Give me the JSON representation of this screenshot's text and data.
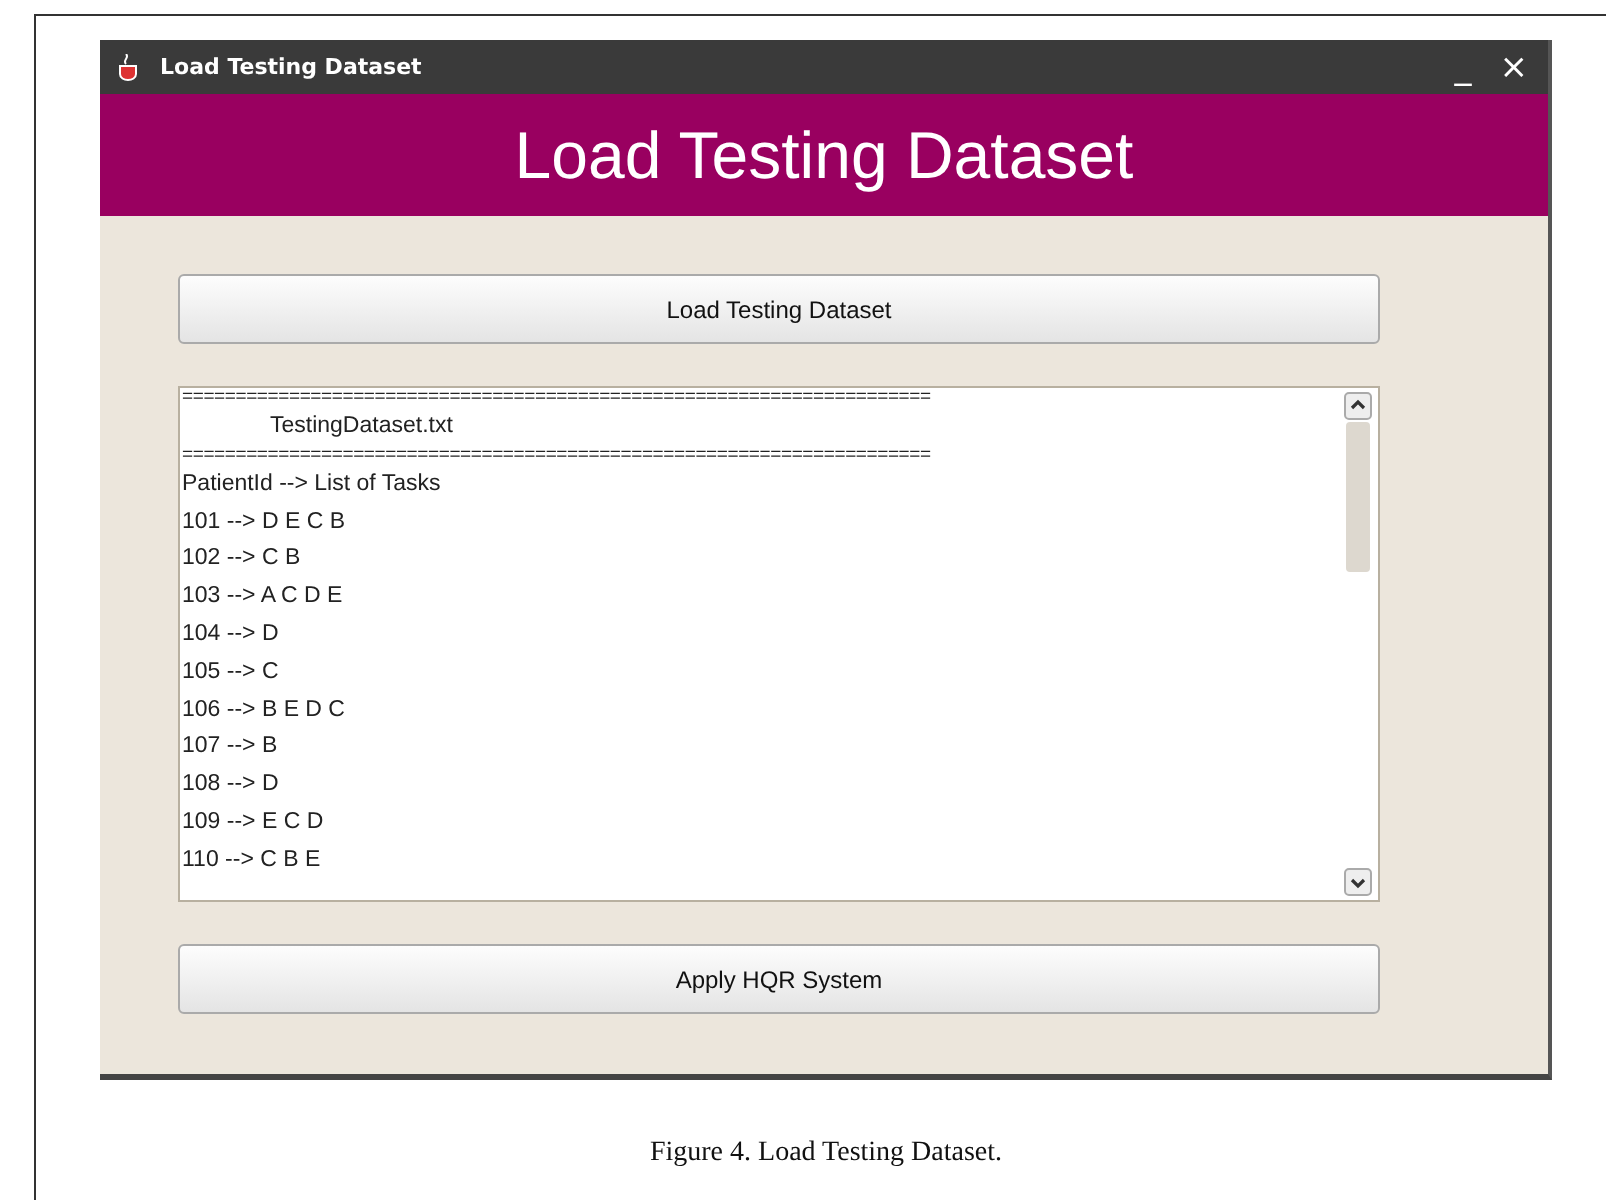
{
  "window": {
    "title": "Load Testing Dataset",
    "controls": [
      "_",
      "×"
    ]
  },
  "banner": {
    "title": "Load Testing Dataset"
  },
  "buttons": [
    {
      "label": "Load Testing Dataset"
    },
    {
      "label": "Apply HQR System"
    }
  ],
  "text_area": {
    "lines": [
      {
        "kind": "rule",
        "text": "======================================================================"
      },
      {
        "kind": "indented",
        "text": "TestingDataset.txt"
      },
      {
        "kind": "rule",
        "text": "======================================================================"
      },
      {
        "kind": "plain",
        "text": "PatientId --> List of Tasks"
      },
      {
        "kind": "plain",
        "text": "101 --> D E C B"
      },
      {
        "kind": "plain",
        "text": "102 --> C B"
      },
      {
        "kind": "plain",
        "text": "103 --> A C D E"
      },
      {
        "kind": "plain",
        "text": "104 --> D"
      },
      {
        "kind": "plain",
        "text": "105 --> C"
      },
      {
        "kind": "plain",
        "text": "106 --> B E D C"
      },
      {
        "kind": "plain",
        "text": "107 --> B"
      },
      {
        "kind": "plain",
        "text": "108 --> D"
      },
      {
        "kind": "plain",
        "text": "109 --> E C D"
      },
      {
        "kind": "plain",
        "text": "110 --> C B E"
      }
    ]
  },
  "caption": "Figure 4.  Load Testing Dataset."
}
